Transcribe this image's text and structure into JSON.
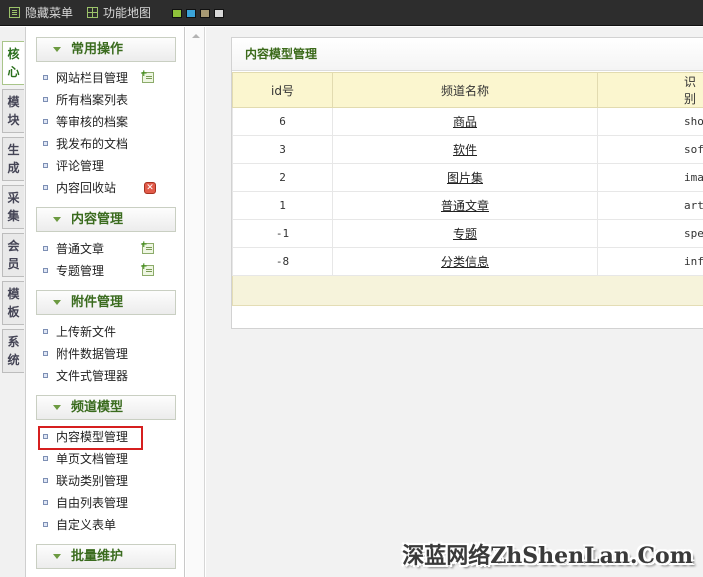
{
  "topbar": {
    "hide_menu_label": "隐藏菜单",
    "sitemap_label": "功能地图",
    "swatches": [
      "#8fc23a",
      "#3aa3d8",
      "#a89a74",
      "#d8d8d8"
    ]
  },
  "vtabs": [
    "核心",
    "模块",
    "生成",
    "采集",
    "会员",
    "模板",
    "系统"
  ],
  "sidebar": {
    "sections": [
      {
        "title": "常用操作",
        "items": [
          "网站栏目管理",
          "所有档案列表",
          "等审核的档案",
          "我发布的文档",
          "评论管理",
          "内容回收站"
        ]
      },
      {
        "title": "内容管理",
        "items": [
          "普通文章",
          "专题管理"
        ]
      },
      {
        "title": "附件管理",
        "items": [
          "上传新文件",
          "附件数据管理",
          "文件式管理器"
        ]
      },
      {
        "title": "频道模型",
        "items": [
          "内容模型管理",
          "单页文档管理",
          "联动类别管理",
          "自由列表管理",
          "自定义表单"
        ]
      },
      {
        "title": "批量维护",
        "items": []
      }
    ]
  },
  "panel": {
    "title": "内容模型管理",
    "columns": [
      "id号",
      "频道名称",
      "识别"
    ],
    "rows": [
      {
        "id": "6",
        "name": "商品",
        "ident": "shop"
      },
      {
        "id": "3",
        "name": "软件",
        "ident": "soft"
      },
      {
        "id": "2",
        "name": "图片集",
        "ident": "image"
      },
      {
        "id": "1",
        "name": "普通文章",
        "ident": "article"
      },
      {
        "id": "-1",
        "name": "专题",
        "ident": "spec"
      },
      {
        "id": "-8",
        "name": "分类信息",
        "ident": "info"
      }
    ]
  },
  "watermark": "深蓝网络ZhShenLan.Com"
}
